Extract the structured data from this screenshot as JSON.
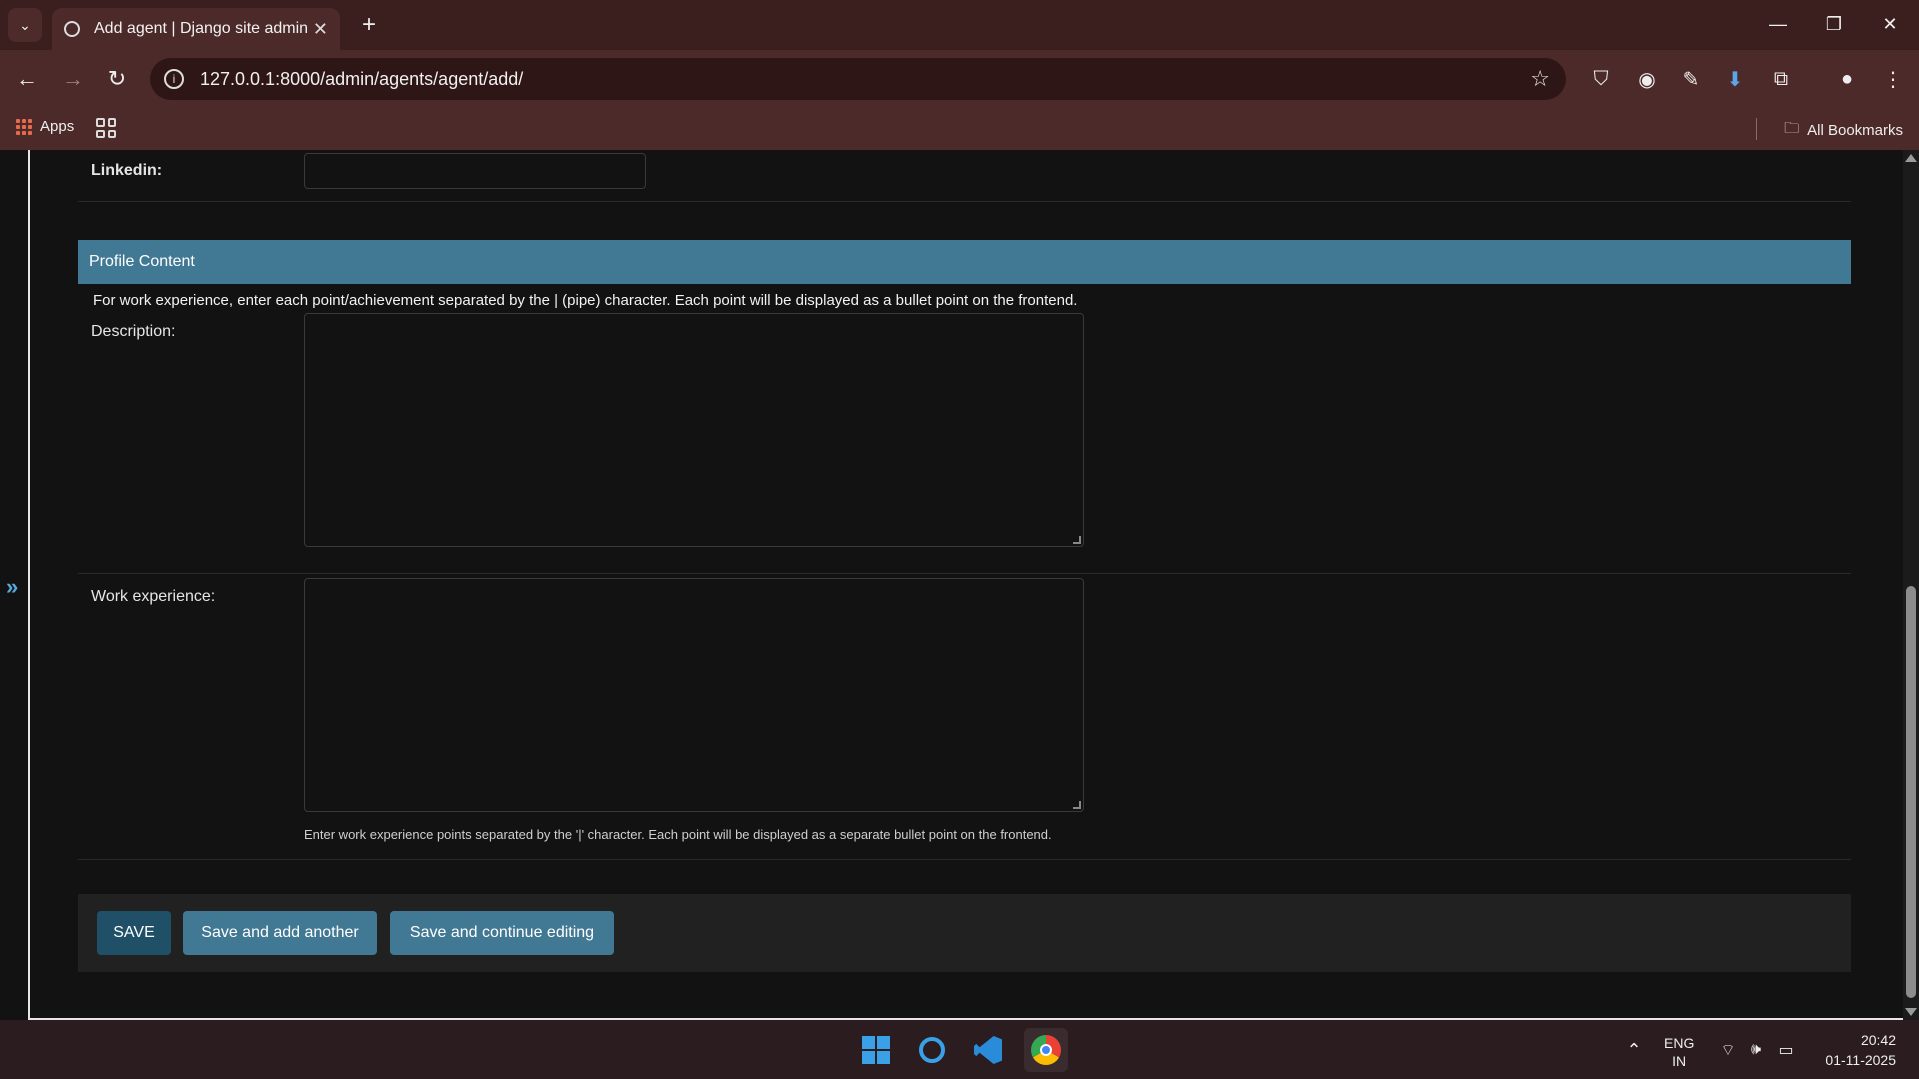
{
  "browser": {
    "tab_title": "Add agent | Django site admin",
    "url": "127.0.0.1:8000/admin/agents/agent/add/",
    "bookmarks": {
      "apps_label": "Apps",
      "all_bookmarks_label": "All Bookmarks"
    }
  },
  "form": {
    "linkedin_label": "Linkedin:",
    "fieldset_title": "Profile Content",
    "fieldset_description": "For work experience, enter each point/achievement separated by the | (pipe) character. Each point will be displayed as a bullet point on the frontend.",
    "description_label": "Description:",
    "description_value": "",
    "work_experience_label": "Work experience:",
    "work_experience_value": "",
    "work_experience_help": "Enter work experience points separated by the '|' character. Each point will be displayed as a separate bullet point on the frontend.",
    "sidebar_toggle": "»"
  },
  "buttons": {
    "save": "SAVE",
    "save_add_another": "Save and add another",
    "save_continue": "Save and continue editing"
  },
  "taskbar": {
    "lang_top": "ENG",
    "lang_bottom": "IN",
    "time": "20:42",
    "date": "01-11-2025"
  },
  "colors": {
    "header_bg": "#417893",
    "primary_button": "#205067",
    "page_bg": "#121212"
  }
}
